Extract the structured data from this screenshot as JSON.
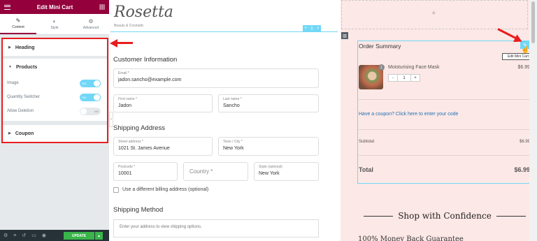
{
  "editor": {
    "title": "Edit Mini Cart",
    "tabs": [
      {
        "label": "Content",
        "icon": "pencil-icon"
      },
      {
        "label": "Style",
        "icon": "contrast-icon"
      },
      {
        "label": "Advanced",
        "icon": "gear-icon"
      }
    ],
    "sections": {
      "heading": "Heading",
      "products": "Products",
      "coupon": "Coupon"
    },
    "controls": [
      {
        "label": "Image",
        "state": "ON"
      },
      {
        "label": "Quantity Switcher",
        "state": "ON"
      },
      {
        "label": "Allow Deletion",
        "state": "NO"
      }
    ],
    "footer": {
      "update_label": "UPDATE"
    }
  },
  "site": {
    "logo": "Rosetta",
    "tagline": "Beauty & Cosmetic"
  },
  "checkout": {
    "customer_title": "Customer Information",
    "email": {
      "label": "Email *",
      "value": "jadon.sancho@example.com"
    },
    "first_name": {
      "label": "First name *",
      "value": "Jadon"
    },
    "last_name": {
      "label": "Last name *",
      "value": "Sancho"
    },
    "shipping_title": "Shipping Address",
    "street": {
      "label": "Street address *",
      "value": "1021 St. James Avenue"
    },
    "city": {
      "label": "Town / City *",
      "value": "New York"
    },
    "postcode": {
      "label": "Postcode *",
      "value": "10001"
    },
    "country": {
      "placeholder": "Country *"
    },
    "state": {
      "label": "State (optional)",
      "value": "New York"
    },
    "billing_label": "Use a different billing address (optional)",
    "method_title": "Shipping Method",
    "method_msg": "Enter your address to view shipping options."
  },
  "order": {
    "title": "Order Summary",
    "product_name": "Moisturising Face Mask",
    "product_price": "$6.99",
    "qty_badge": "1",
    "qty_value": "1",
    "qty_minus": "-",
    "qty_plus": "+",
    "coupon_text": "Have a coupon? Click here to enter your code",
    "subtotal_label": "Subtotal",
    "subtotal_value": "$6.99",
    "total_label": "Total",
    "total_value": "$6.99",
    "edit_tooltip": "Edit Mini Cart",
    "confidence_title": "Shop with Confidence",
    "cut_text": "100% Money Back Guarantee"
  },
  "colors": {
    "brand": "#93003c",
    "accent": "#71d7f7",
    "annotation": "#e81e1e",
    "update": "#39b54a"
  }
}
